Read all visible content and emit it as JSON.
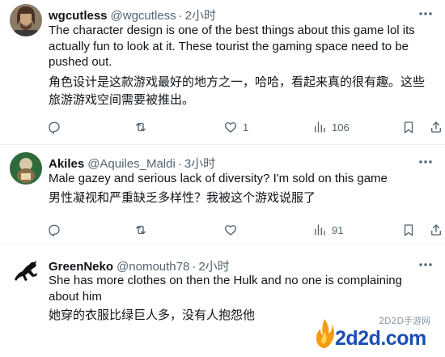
{
  "tweets": [
    {
      "name": "wgcutless",
      "handle": "@wgcutless",
      "sep": "·",
      "time": "2小时",
      "text": "The character design is one of the best things about this game lol its actually fun to look at it. These tourist the gaming space need to be pushed out.",
      "translation": "角色设计是这款游戏最好的地方之一，哈哈，看起来真的很有趣。这些旅游游戏空间需要被推出。",
      "likes": "1",
      "views": "106"
    },
    {
      "name": "Akiles",
      "handle": "@Aquiles_Maldi",
      "sep": "·",
      "time": "3小时",
      "text": "Male gazey and serious lack of diversity? I'm sold on this game",
      "translation": "男性凝视和严重缺乏多样性？我被这个游戏说服了",
      "likes": "",
      "views": "91"
    },
    {
      "name": "GreenNeko",
      "handle": "@nomouth78",
      "sep": "·",
      "time": "2小时",
      "text": "She has more clothes on then the Hulk and no one is complaining about him",
      "translation": "她穿的衣服比绿巨人多，没有人抱怨他"
    }
  ],
  "watermark": {
    "site": "2D2D手游网",
    "logo": "2d2d.com"
  },
  "colors": {
    "text": "#0f1419",
    "secondary": "#536471",
    "divider": "#eff3f4"
  },
  "icons": [
    "more-icon",
    "reply-icon",
    "retweet-icon",
    "like-icon",
    "views-icon",
    "bookmark-icon",
    "share-icon"
  ]
}
